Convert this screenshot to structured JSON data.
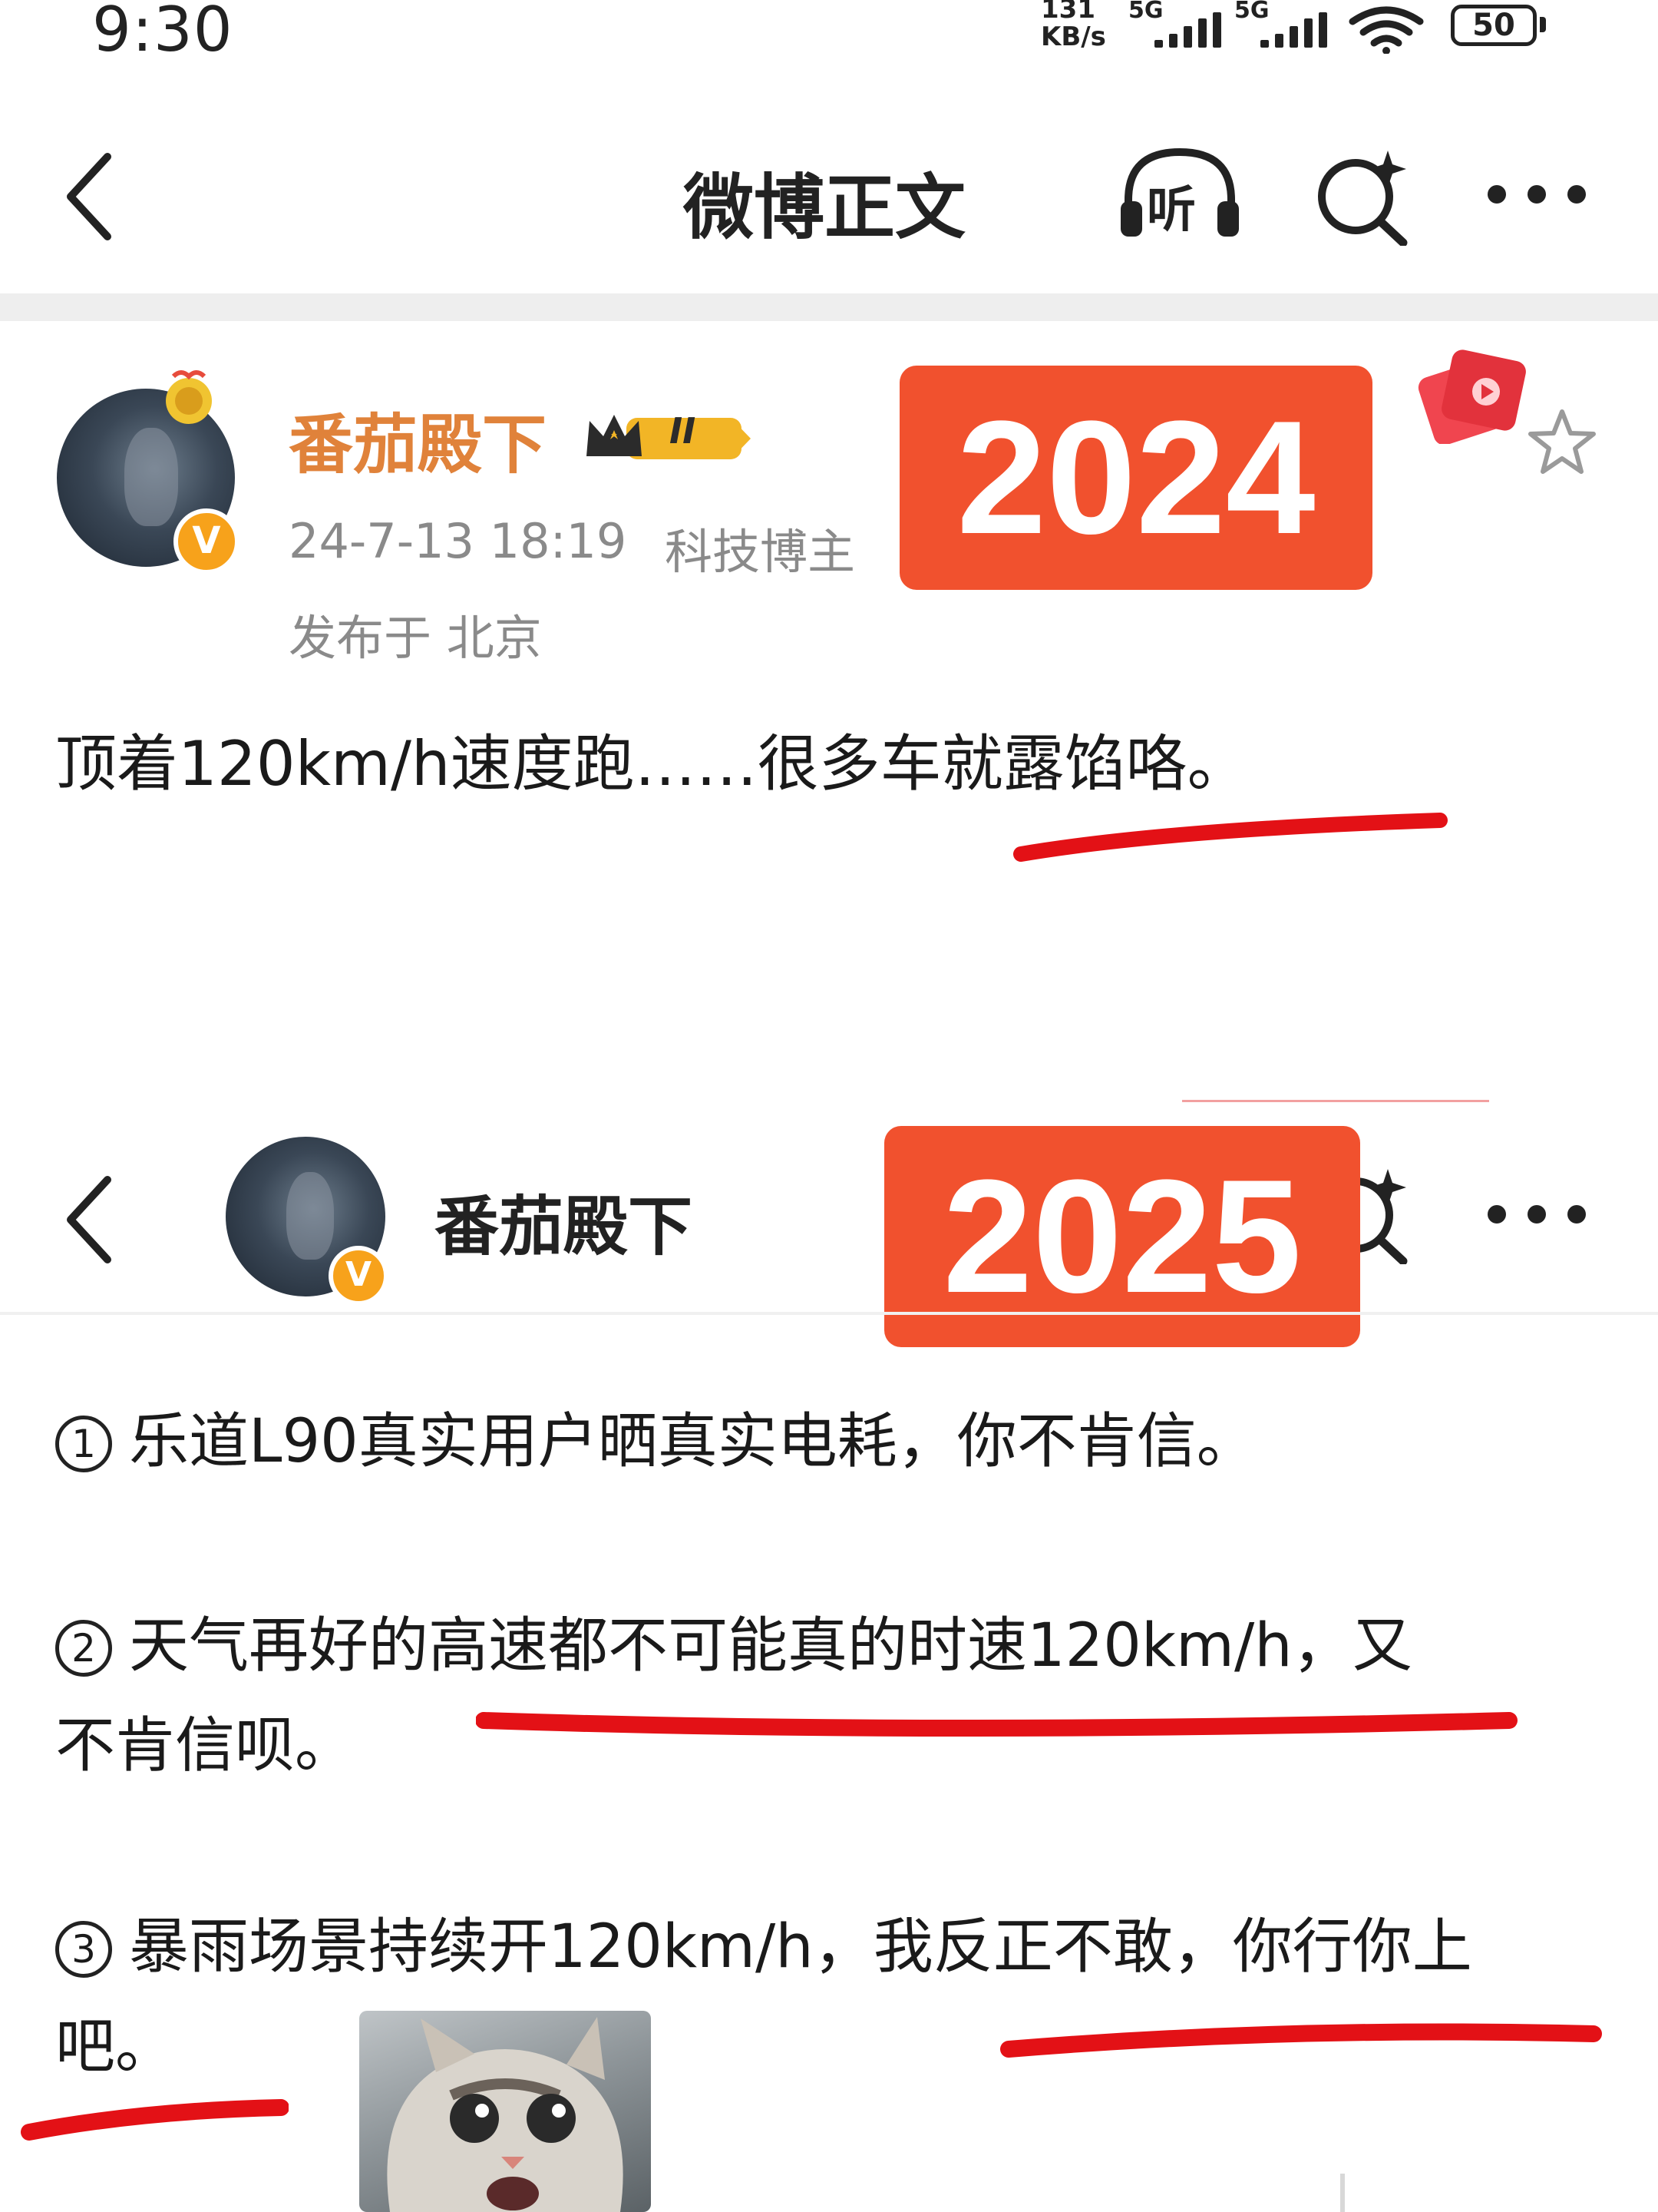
{
  "status_bar": {
    "time": "9:30",
    "net_speed_top": "131",
    "net_speed_bottom": "KB/s",
    "sim1_label": "5G",
    "sim2_label": "5G",
    "battery": "50"
  },
  "header": {
    "title": "微博正文",
    "listen_label": "听"
  },
  "post_2024": {
    "username": "番茄殿下",
    "member_level": "II",
    "verified_mark": "V",
    "timestamp": "24-7-13 18:19",
    "tag": "科技博主",
    "location": "发布于 北京",
    "text": "顶着120km/h速度跑……很多车就露馅咯。",
    "year_label": "2024"
  },
  "post_2025": {
    "username": "番茄殿下",
    "verified_mark": "V",
    "year_label": "2025",
    "points": [
      {
        "num": "1",
        "line1": "乐道L90真实用户晒真实电耗，你不肯信。",
        "line2": ""
      },
      {
        "num": "2",
        "line1": "天气再好的高速都不可能真的时速120km/h，又",
        "line2": "不肯信呗。"
      },
      {
        "num": "3",
        "line1": "暴雨场景持续开120km/h，我反正不敢，你行你上",
        "line2": "吧。"
      }
    ]
  },
  "colors": {
    "annotation_red": "#e31116",
    "year_box": "#f1512e",
    "username_orange": "#e0823a",
    "verified_orange": "#f7a21b"
  },
  "icons": [
    "back-icon",
    "headphones-icon",
    "search-sparkle-icon",
    "more-icon",
    "star-icon",
    "red-packet-icon",
    "crown-badge-icon"
  ]
}
